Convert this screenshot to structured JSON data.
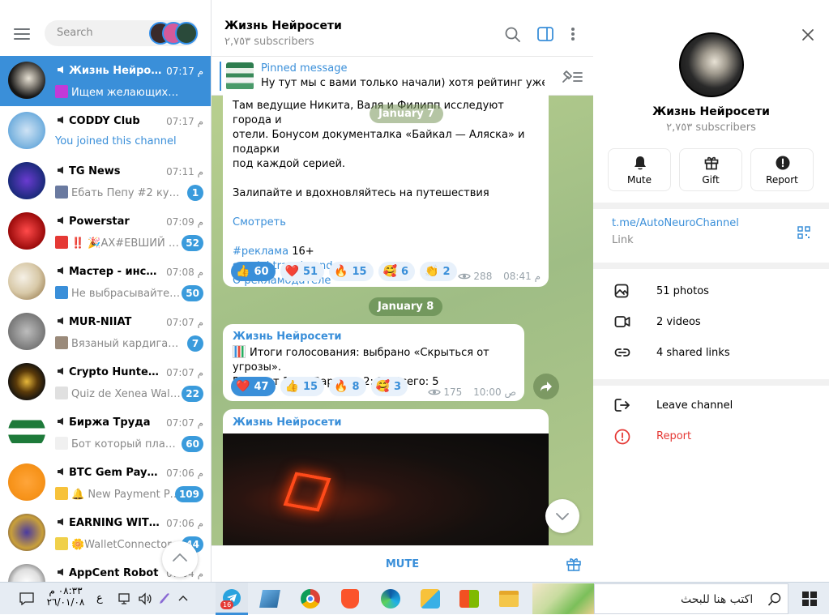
{
  "sidebar": {
    "search_placeholder": "Search",
    "chats": [
      {
        "name": "Жизнь Нейросе...",
        "time": "م 07:17",
        "preview": "Ищем желающих запол...",
        "badge": "",
        "active": true
      },
      {
        "name": "CODDY Club",
        "time": "م 07:17",
        "preview": "You joined this channel",
        "badge": "",
        "active": false
      },
      {
        "name": "TG News",
        "time": "م 07:11",
        "preview": "Ебать  Пепу #2 купи...",
        "badge": "1",
        "active": false
      },
      {
        "name": "Powerstar",
        "time": "م 07:09",
        "preview": "‼️ 🎉АХ#ЕВШИЙ Б...",
        "badge": "52",
        "active": false
      },
      {
        "name": "Мастер - инстр...",
        "time": "م 07:08",
        "preview": "Не выбрасывайте с...",
        "badge": "50",
        "active": false
      },
      {
        "name": "MUR-NIIAT",
        "time": "م 07:07",
        "preview": "Вязаный кардиган н...",
        "badge": "7",
        "active": false
      },
      {
        "name": "Crypto Hunters...",
        "time": "م 07:07",
        "preview": "Quiz de Xenea Walle...",
        "badge": "22",
        "active": false
      },
      {
        "name": "Биржа Труда",
        "time": "م 07:07",
        "preview": "Бот который плати...",
        "badge": "60",
        "active": false
      },
      {
        "name": "BTC Gem Payout",
        "time": "م 07:06",
        "preview": "🔔 New Payment Proc...",
        "badge": "109",
        "active": false
      },
      {
        "name": "EARNING WITH ...",
        "time": "م 07:06",
        "preview": "🌼WalletConnector...",
        "badge": "44",
        "active": false
      },
      {
        "name": "AppCent Robot",
        "time": "م 07:04",
        "preview": "",
        "badge": "",
        "active": false
      }
    ]
  },
  "chat": {
    "title": "Жизнь Нейросети",
    "subscribers": "٢,٧٥٣ subscribers",
    "pinned_label": "Pinned message",
    "pinned_text": "Ну тут мы с вами только начали) хотя рейтинг уже хо...",
    "msg1": {
      "line1": "Там ведущие Никита, Валя и Филипп исследуют города и",
      "line2": "отели. Бонусом документалка «Байкал — Аляска» и подарки",
      "line3": "под каждой серией.",
      "line4": "Залипайте и вдохновляйтесь на путешествия",
      "watch": "Смотреть",
      "hashtag": "#реклама",
      "age": "16+",
      "site": "special.travel.yandex.ru",
      "about": "О рекламодателе",
      "reactions": [
        {
          "emoji": "👍",
          "count": "60",
          "sel": true
        },
        {
          "emoji": "❤️",
          "count": "51",
          "sel": false
        },
        {
          "emoji": "🔥",
          "count": "15",
          "sel": false
        },
        {
          "emoji": "🥰",
          "count": "6",
          "sel": false
        },
        {
          "emoji": "👏",
          "count": "2",
          "sel": false
        }
      ],
      "views": "288",
      "time": "08:41 م"
    },
    "date_sticky": "January 7",
    "date2": "January 8",
    "msg2": {
      "author": "Жизнь Нейросети",
      "poll_line": "Итоги голосования: выбрано «Скрыться от угрозы».",
      "poll_result": "Вариант 1: 3 | Вариант 2: 2 | Всего: 5",
      "reactions": [
        {
          "emoji": "❤️",
          "count": "47",
          "sel": true
        },
        {
          "emoji": "👍",
          "count": "15",
          "sel": false
        },
        {
          "emoji": "🔥",
          "count": "8",
          "sel": false
        },
        {
          "emoji": "🥰",
          "count": "3",
          "sel": false
        }
      ],
      "views": "175",
      "time": "10:00 ص"
    },
    "msg3": {
      "author": "Жизнь Нейросети"
    },
    "mute_label": "MUTE"
  },
  "profile": {
    "name": "Жизнь Нейросети",
    "subscribers": "٢,٧٥٣ subscribers",
    "actions": [
      {
        "label": "Mute",
        "icon": "bell-icon"
      },
      {
        "label": "Gift",
        "icon": "gift-icon"
      },
      {
        "label": "Report",
        "icon": "report-icon"
      }
    ],
    "link": "t.me/AutoNeuroChannel",
    "link_label": "Link",
    "media": [
      {
        "label": "51 photos",
        "icon": "photo-icon"
      },
      {
        "label": "2 videos",
        "icon": "video-icon"
      },
      {
        "label": "4 shared links",
        "icon": "link-icon"
      }
    ],
    "leave": "Leave channel",
    "report": "Report"
  },
  "taskbar": {
    "search_text": "اكتب هنا للبحث",
    "time": "٠٨:٣٣ م",
    "date": "٢٦/٠١/٠٨",
    "lang": "ع",
    "telegram_badge": "16"
  },
  "colors": {
    "accent": "#3a8fd9",
    "report_red": "#e53935",
    "badge": "#3a9bdc"
  }
}
